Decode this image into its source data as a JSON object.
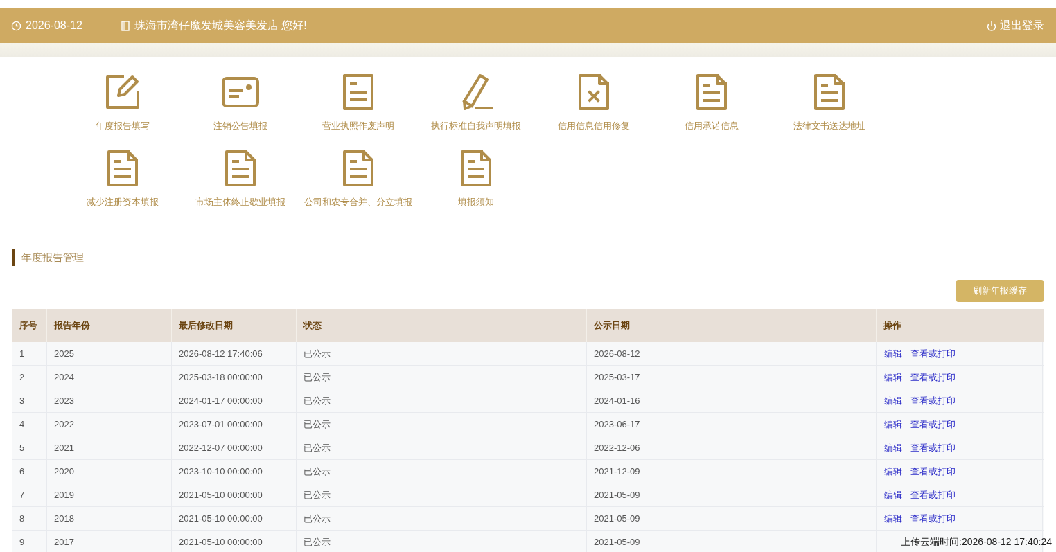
{
  "header": {
    "date": "2026-08-12",
    "greeting": "珠海市湾仔魔发城美容美发店 您好!",
    "logout": "退出登录"
  },
  "menu": [
    {
      "kind": "edit",
      "label": "年度报告填写"
    },
    {
      "kind": "card",
      "label": "注销公告填报"
    },
    {
      "kind": "doc",
      "label": "营业执照作废声明"
    },
    {
      "kind": "pencil",
      "label": "执行标准自我声明填报"
    },
    {
      "kind": "doc-x",
      "label": "信用信息信用修复"
    },
    {
      "kind": "doc-fold",
      "label": "信用承诺信息"
    },
    {
      "kind": "doc-fold",
      "label": "法律文书送达地址"
    },
    {
      "kind": "doc-fold",
      "label": "减少注册资本填报"
    },
    {
      "kind": "doc-fold",
      "label": "市场主体终止歇业填报"
    },
    {
      "kind": "doc-fold",
      "label": "公司和农专合并、分立填报"
    },
    {
      "kind": "doc-fold",
      "label": "填报须知"
    }
  ],
  "section": {
    "title": "年度报告管理",
    "refresh_button": "刷新年报缓存"
  },
  "table": {
    "columns": [
      "序号",
      "报告年份",
      "最后修改日期",
      "状态",
      "公示日期",
      "操作"
    ],
    "rows": [
      {
        "cells": [
          "1",
          "2025",
          "2026-08-12 17:40:06",
          "已公示",
          "2026-08-12"
        ],
        "actions": [
          "编辑",
          "查看或打印"
        ]
      },
      {
        "cells": [
          "2",
          "2024",
          "2025-03-18 00:00:00",
          "已公示",
          "2025-03-17"
        ],
        "actions": [
          "编辑",
          "查看或打印"
        ]
      },
      {
        "cells": [
          "3",
          "2023",
          "2024-01-17 00:00:00",
          "已公示",
          "2024-01-16"
        ],
        "actions": [
          "编辑",
          "查看或打印"
        ]
      },
      {
        "cells": [
          "4",
          "2022",
          "2023-07-01 00:00:00",
          "已公示",
          "2023-06-17"
        ],
        "actions": [
          "编辑",
          "查看或打印"
        ]
      },
      {
        "cells": [
          "5",
          "2021",
          "2022-12-07 00:00:00",
          "已公示",
          "2022-12-06"
        ],
        "actions": [
          "编辑",
          "查看或打印"
        ]
      },
      {
        "cells": [
          "6",
          "2020",
          "2023-10-10 00:00:00",
          "已公示",
          "2021-12-09"
        ],
        "actions": [
          "编辑",
          "查看或打印"
        ]
      },
      {
        "cells": [
          "7",
          "2019",
          "2021-05-10 00:00:00",
          "已公示",
          "2021-05-09"
        ],
        "actions": [
          "编辑",
          "查看或打印"
        ]
      },
      {
        "cells": [
          "8",
          "2018",
          "2021-05-10 00:00:00",
          "已公示",
          "2021-05-09"
        ],
        "actions": [
          "编辑",
          "查看或打印"
        ]
      },
      {
        "cells": [
          "9",
          "2017",
          "2021-05-10 00:00:00",
          "已公示",
          "2021-05-09"
        ]
      }
    ]
  },
  "capture_stamp": "上传云端时间:2026-08-12 17:40:24"
}
